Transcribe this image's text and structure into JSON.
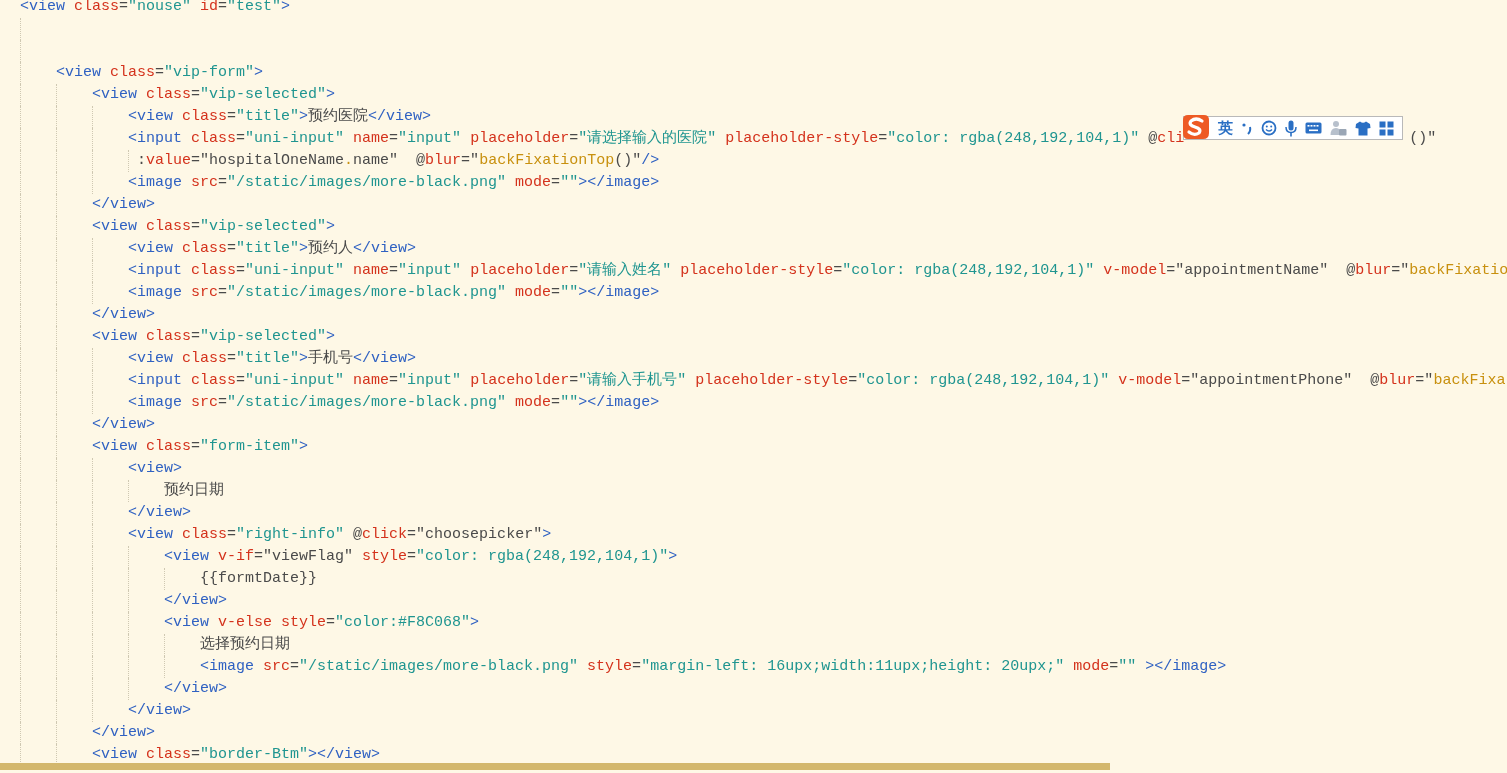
{
  "editor": {
    "lines": [
      {
        "kind": "code",
        "tokens": [
          {
            "kind": "tag",
            "text": "<view"
          },
          {
            "kind": "attr",
            "text": " class"
          },
          {
            "kind": "plain",
            "text": "="
          },
          {
            "kind": "str",
            "text": "\"nouse\""
          },
          {
            "kind": "attr",
            "text": " id"
          },
          {
            "kind": "plain",
            "text": "="
          },
          {
            "kind": "str",
            "text": "\"test\""
          },
          {
            "kind": "tag",
            "text": ">"
          }
        ],
        "children": [
          {
            "kind": "blank"
          },
          {
            "kind": "blank"
          },
          {
            "kind": "code",
            "tokens": [
              {
                "kind": "tag",
                "text": "<view"
              },
              {
                "kind": "attr",
                "text": " class"
              },
              {
                "kind": "plain",
                "text": "="
              },
              {
                "kind": "str",
                "text": "\"vip-form\""
              },
              {
                "kind": "tag",
                "text": ">"
              }
            ],
            "children": [
              {
                "kind": "code",
                "tokens": [
                  {
                    "kind": "tag",
                    "text": "<view"
                  },
                  {
                    "kind": "attr",
                    "text": " class"
                  },
                  {
                    "kind": "plain",
                    "text": "="
                  },
                  {
                    "kind": "str",
                    "text": "\"vip-selected\""
                  },
                  {
                    "kind": "tag",
                    "text": ">"
                  }
                ],
                "children": [
                  {
                    "kind": "code",
                    "tokens": [
                      {
                        "kind": "tag",
                        "text": "<view"
                      },
                      {
                        "kind": "attr",
                        "text": " class"
                      },
                      {
                        "kind": "plain",
                        "text": "="
                      },
                      {
                        "kind": "str",
                        "text": "\"title\""
                      },
                      {
                        "kind": "tag",
                        "text": ">"
                      },
                      {
                        "kind": "plain",
                        "text": "预约医院"
                      },
                      {
                        "kind": "tag",
                        "text": "</view>"
                      }
                    ]
                  },
                  {
                    "kind": "code",
                    "tokens": [
                      {
                        "kind": "tag",
                        "text": "<input"
                      },
                      {
                        "kind": "attr",
                        "text": " class"
                      },
                      {
                        "kind": "plain",
                        "text": "="
                      },
                      {
                        "kind": "str",
                        "text": "\"uni-input\""
                      },
                      {
                        "kind": "attr",
                        "text": " name"
                      },
                      {
                        "kind": "plain",
                        "text": "="
                      },
                      {
                        "kind": "str",
                        "text": "\"input\""
                      },
                      {
                        "kind": "attr",
                        "text": " placeholder"
                      },
                      {
                        "kind": "plain",
                        "text": "="
                      },
                      {
                        "kind": "str",
                        "text": "\"请选择输入的医院\""
                      },
                      {
                        "kind": "attr",
                        "text": " placeholder-style"
                      },
                      {
                        "kind": "plain",
                        "text": "="
                      },
                      {
                        "kind": "str",
                        "text": "\"color: rgba(248,192,104,1)\""
                      },
                      {
                        "kind": "plain",
                        "text": " @"
                      },
                      {
                        "kind": "attr",
                        "text": "cli"
                      },
                      {
                        "kind": "covered"
                      },
                      {
                        "kind": "plain",
                        "text": "()\""
                      }
                    ],
                    "wrap": [
                      {
                        "kind": "plain",
                        "text": ":"
                      },
                      {
                        "kind": "attr",
                        "text": "value"
                      },
                      {
                        "kind": "plain",
                        "text": "=\"hospitalOneName"
                      },
                      {
                        "kind": "fn",
                        "text": "."
                      },
                      {
                        "kind": "plain",
                        "text": "name\"  @"
                      },
                      {
                        "kind": "attr",
                        "text": "blur"
                      },
                      {
                        "kind": "plain",
                        "text": "=\""
                      },
                      {
                        "kind": "fn",
                        "text": "backFixationTop"
                      },
                      {
                        "kind": "plain",
                        "text": "()\""
                      },
                      {
                        "kind": "tag",
                        "text": "/>"
                      }
                    ]
                  },
                  {
                    "kind": "code",
                    "tokens": [
                      {
                        "kind": "tag",
                        "text": "<image"
                      },
                      {
                        "kind": "attr",
                        "text": " src"
                      },
                      {
                        "kind": "plain",
                        "text": "="
                      },
                      {
                        "kind": "str",
                        "text": "\"/static/images/more-black.png\""
                      },
                      {
                        "kind": "attr",
                        "text": " mode"
                      },
                      {
                        "kind": "plain",
                        "text": "="
                      },
                      {
                        "kind": "str",
                        "text": "\"\""
                      },
                      {
                        "kind": "tag",
                        "text": "></image>"
                      }
                    ]
                  }
                ]
              },
              {
                "kind": "code",
                "tokens": [
                  {
                    "kind": "tag",
                    "text": "</view>"
                  }
                ]
              },
              {
                "kind": "code",
                "tokens": [
                  {
                    "kind": "tag",
                    "text": "<view"
                  },
                  {
                    "kind": "attr",
                    "text": " class"
                  },
                  {
                    "kind": "plain",
                    "text": "="
                  },
                  {
                    "kind": "str",
                    "text": "\"vip-selected\""
                  },
                  {
                    "kind": "tag",
                    "text": ">"
                  }
                ],
                "children": [
                  {
                    "kind": "code",
                    "tokens": [
                      {
                        "kind": "tag",
                        "text": "<view"
                      },
                      {
                        "kind": "attr",
                        "text": " class"
                      },
                      {
                        "kind": "plain",
                        "text": "="
                      },
                      {
                        "kind": "str",
                        "text": "\"title\""
                      },
                      {
                        "kind": "tag",
                        "text": ">"
                      },
                      {
                        "kind": "plain",
                        "text": "预约人"
                      },
                      {
                        "kind": "tag",
                        "text": "</view>"
                      }
                    ]
                  },
                  {
                    "kind": "code",
                    "tokens": [
                      {
                        "kind": "tag",
                        "text": "<input"
                      },
                      {
                        "kind": "attr",
                        "text": " class"
                      },
                      {
                        "kind": "plain",
                        "text": "="
                      },
                      {
                        "kind": "str",
                        "text": "\"uni-input\""
                      },
                      {
                        "kind": "attr",
                        "text": " name"
                      },
                      {
                        "kind": "plain",
                        "text": "="
                      },
                      {
                        "kind": "str",
                        "text": "\"input\""
                      },
                      {
                        "kind": "attr",
                        "text": " placeholder"
                      },
                      {
                        "kind": "plain",
                        "text": "="
                      },
                      {
                        "kind": "str",
                        "text": "\"请输入姓名\""
                      },
                      {
                        "kind": "attr",
                        "text": " placeholder-style"
                      },
                      {
                        "kind": "plain",
                        "text": "="
                      },
                      {
                        "kind": "str",
                        "text": "\"color: rgba(248,192,104,1)\""
                      },
                      {
                        "kind": "attr",
                        "text": " v-model"
                      },
                      {
                        "kind": "plain",
                        "text": "=\"appointmentName\"  @"
                      },
                      {
                        "kind": "attr",
                        "text": "blur"
                      },
                      {
                        "kind": "plain",
                        "text": "=\""
                      },
                      {
                        "kind": "fn",
                        "text": "backFixatio"
                      }
                    ]
                  },
                  {
                    "kind": "code",
                    "tokens": [
                      {
                        "kind": "tag",
                        "text": "<image"
                      },
                      {
                        "kind": "attr",
                        "text": " src"
                      },
                      {
                        "kind": "plain",
                        "text": "="
                      },
                      {
                        "kind": "str",
                        "text": "\"/static/images/more-black.png\""
                      },
                      {
                        "kind": "attr",
                        "text": " mode"
                      },
                      {
                        "kind": "plain",
                        "text": "="
                      },
                      {
                        "kind": "str",
                        "text": "\"\""
                      },
                      {
                        "kind": "tag",
                        "text": "></image>"
                      }
                    ]
                  }
                ]
              },
              {
                "kind": "code",
                "tokens": [
                  {
                    "kind": "tag",
                    "text": "</view>"
                  }
                ]
              },
              {
                "kind": "code",
                "tokens": [
                  {
                    "kind": "tag",
                    "text": "<view"
                  },
                  {
                    "kind": "attr",
                    "text": " class"
                  },
                  {
                    "kind": "plain",
                    "text": "="
                  },
                  {
                    "kind": "str",
                    "text": "\"vip-selected\""
                  },
                  {
                    "kind": "tag",
                    "text": ">"
                  }
                ],
                "children": [
                  {
                    "kind": "code",
                    "tokens": [
                      {
                        "kind": "tag",
                        "text": "<view"
                      },
                      {
                        "kind": "attr",
                        "text": " class"
                      },
                      {
                        "kind": "plain",
                        "text": "="
                      },
                      {
                        "kind": "str",
                        "text": "\"title\""
                      },
                      {
                        "kind": "tag",
                        "text": ">"
                      },
                      {
                        "kind": "plain",
                        "text": "手机号"
                      },
                      {
                        "kind": "tag",
                        "text": "</view>"
                      }
                    ]
                  },
                  {
                    "kind": "code",
                    "tokens": [
                      {
                        "kind": "tag",
                        "text": "<input"
                      },
                      {
                        "kind": "attr",
                        "text": " class"
                      },
                      {
                        "kind": "plain",
                        "text": "="
                      },
                      {
                        "kind": "str",
                        "text": "\"uni-input\""
                      },
                      {
                        "kind": "attr",
                        "text": " name"
                      },
                      {
                        "kind": "plain",
                        "text": "="
                      },
                      {
                        "kind": "str",
                        "text": "\"input\""
                      },
                      {
                        "kind": "attr",
                        "text": " placeholder"
                      },
                      {
                        "kind": "plain",
                        "text": "="
                      },
                      {
                        "kind": "str",
                        "text": "\"请输入手机号\""
                      },
                      {
                        "kind": "attr",
                        "text": " placeholder-style"
                      },
                      {
                        "kind": "plain",
                        "text": "="
                      },
                      {
                        "kind": "str",
                        "text": "\"color: rgba(248,192,104,1)\""
                      },
                      {
                        "kind": "attr",
                        "text": " v-model"
                      },
                      {
                        "kind": "plain",
                        "text": "=\"appointmentPhone\"  @"
                      },
                      {
                        "kind": "attr",
                        "text": "blur"
                      },
                      {
                        "kind": "plain",
                        "text": "=\""
                      },
                      {
                        "kind": "fn",
                        "text": "backFixa"
                      }
                    ]
                  },
                  {
                    "kind": "code",
                    "tokens": [
                      {
                        "kind": "tag",
                        "text": "<image"
                      },
                      {
                        "kind": "attr",
                        "text": " src"
                      },
                      {
                        "kind": "plain",
                        "text": "="
                      },
                      {
                        "kind": "str",
                        "text": "\"/static/images/more-black.png\""
                      },
                      {
                        "kind": "attr",
                        "text": " mode"
                      },
                      {
                        "kind": "plain",
                        "text": "="
                      },
                      {
                        "kind": "str",
                        "text": "\"\""
                      },
                      {
                        "kind": "tag",
                        "text": "></image>"
                      }
                    ]
                  }
                ]
              },
              {
                "kind": "code",
                "tokens": [
                  {
                    "kind": "tag",
                    "text": "</view>"
                  }
                ]
              },
              {
                "kind": "code",
                "tokens": [
                  {
                    "kind": "tag",
                    "text": "<view"
                  },
                  {
                    "kind": "attr",
                    "text": " class"
                  },
                  {
                    "kind": "plain",
                    "text": "="
                  },
                  {
                    "kind": "str",
                    "text": "\"form-item\""
                  },
                  {
                    "kind": "tag",
                    "text": ">"
                  }
                ],
                "children": [
                  {
                    "kind": "code",
                    "tokens": [
                      {
                        "kind": "tag",
                        "text": "<view>"
                      }
                    ],
                    "children": [
                      {
                        "kind": "code",
                        "tokens": [
                          {
                            "kind": "plain",
                            "text": "预约日期"
                          }
                        ]
                      }
                    ]
                  },
                  {
                    "kind": "code",
                    "tokens": [
                      {
                        "kind": "tag",
                        "text": "</view>"
                      }
                    ]
                  },
                  {
                    "kind": "code",
                    "tokens": [
                      {
                        "kind": "tag",
                        "text": "<view"
                      },
                      {
                        "kind": "attr",
                        "text": " class"
                      },
                      {
                        "kind": "plain",
                        "text": "="
                      },
                      {
                        "kind": "str",
                        "text": "\"right-info\""
                      },
                      {
                        "kind": "plain",
                        "text": " @"
                      },
                      {
                        "kind": "attr",
                        "text": "click"
                      },
                      {
                        "kind": "plain",
                        "text": "=\"choosepicker\""
                      },
                      {
                        "kind": "tag",
                        "text": ">"
                      }
                    ],
                    "children": [
                      {
                        "kind": "code",
                        "tokens": [
                          {
                            "kind": "tag",
                            "text": "<view"
                          },
                          {
                            "kind": "attr",
                            "text": " v-if"
                          },
                          {
                            "kind": "plain",
                            "text": "=\"viewFlag\""
                          },
                          {
                            "kind": "attr",
                            "text": " style"
                          },
                          {
                            "kind": "plain",
                            "text": "="
                          },
                          {
                            "kind": "str",
                            "text": "\"color: rgba(248,192,104,1)\""
                          },
                          {
                            "kind": "tag",
                            "text": ">"
                          }
                        ],
                        "children": [
                          {
                            "kind": "code",
                            "tokens": [
                              {
                                "kind": "plain",
                                "text": "{{formtDate}}"
                              }
                            ]
                          }
                        ]
                      },
                      {
                        "kind": "code",
                        "tokens": [
                          {
                            "kind": "tag",
                            "text": "</view>"
                          }
                        ]
                      },
                      {
                        "kind": "code",
                        "tokens": [
                          {
                            "kind": "tag",
                            "text": "<view"
                          },
                          {
                            "kind": "attr",
                            "text": " v-else"
                          },
                          {
                            "kind": "attr",
                            "text": " style"
                          },
                          {
                            "kind": "plain",
                            "text": "="
                          },
                          {
                            "kind": "str",
                            "text": "\"color:#F8C068\""
                          },
                          {
                            "kind": "tag",
                            "text": ">"
                          }
                        ],
                        "children": [
                          {
                            "kind": "code",
                            "tokens": [
                              {
                                "kind": "plain",
                                "text": "选择预约日期"
                              }
                            ]
                          },
                          {
                            "kind": "code",
                            "tokens": [
                              {
                                "kind": "tag",
                                "text": "<image"
                              },
                              {
                                "kind": "attr",
                                "text": " src"
                              },
                              {
                                "kind": "plain",
                                "text": "="
                              },
                              {
                                "kind": "str",
                                "text": "\"/static/images/more-black.png\""
                              },
                              {
                                "kind": "attr",
                                "text": " style"
                              },
                              {
                                "kind": "plain",
                                "text": "="
                              },
                              {
                                "kind": "str",
                                "text": "\"margin-left: 16upx;width:11upx;height: 20upx;\""
                              },
                              {
                                "kind": "attr",
                                "text": " mode"
                              },
                              {
                                "kind": "plain",
                                "text": "="
                              },
                              {
                                "kind": "str",
                                "text": "\"\""
                              },
                              {
                                "kind": "tag",
                                "text": " ></image>"
                              }
                            ]
                          }
                        ]
                      },
                      {
                        "kind": "code",
                        "tokens": [
                          {
                            "kind": "tag",
                            "text": "</view>"
                          }
                        ]
                      }
                    ]
                  },
                  {
                    "kind": "code",
                    "tokens": [
                      {
                        "kind": "tag",
                        "text": "</view>"
                      }
                    ]
                  }
                ]
              },
              {
                "kind": "code",
                "tokens": [
                  {
                    "kind": "tag",
                    "text": "</view>"
                  }
                ]
              },
              {
                "kind": "code",
                "tokens": [
                  {
                    "kind": "tag",
                    "text": "<view"
                  },
                  {
                    "kind": "attr",
                    "text": " class"
                  },
                  {
                    "kind": "plain",
                    "text": "="
                  },
                  {
                    "kind": "str",
                    "text": "\"border-Btm\""
                  },
                  {
                    "kind": "tag",
                    "text": "></view>"
                  }
                ]
              }
            ]
          }
        ]
      }
    ]
  },
  "ime_toolbar": {
    "mode_label": "英"
  }
}
